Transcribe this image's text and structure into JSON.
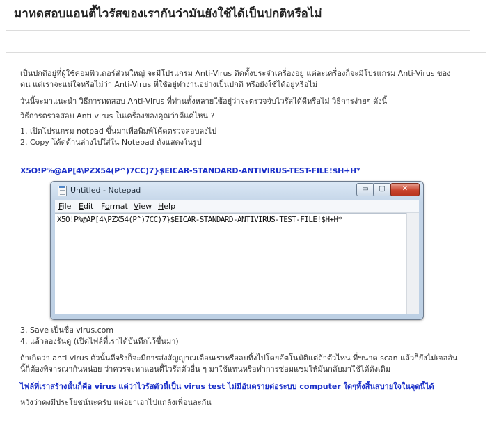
{
  "page": {
    "title": "มาทดสอบแอนตี้ไวรัสของเรากันว่ามันยังใช้ได้เป็นปกติหรือไม่"
  },
  "body": {
    "p1": "เป็นปกติอยู่ที่ผู้ใช้คอมพิวเตอร์ส่วนใหญ่ จะมีโปรแกรม Anti-Virus ติดตั้งประจำเครื่องอยู่ แต่ละเครื่องก็จะมีโปรแกรม Anti-Virus ของตน แต่เราจะแน่ใจหรือไม่ว่า Anti-Virus ที่ใช้อยู่ทำงานอย่างเป็นปกติ หรือยังใช้ได้อยู่หรือไม่",
    "p2": "วันนี้จะมาแนะนำ วิธีการทดสอบ Anti-Virus ที่ท่านทั้งหลายใช้อยู่ว่าจะตรวจจับไวรัสได้ดีหรือไม่ วิธีการง่ายๆ ดังนี้",
    "p3": "วิธีการตรวจสอบ Anti virus ในเครื่องของคุณว่าดีแค่ไหน ?",
    "step1": "1. เปิดโปรแกรม notpad ขึ้นมาเพื่อพิมพ์โค้ดตรวจสอบลงไป",
    "step2": "2. Copy โค้ดด้านล่างไปใส่ใน Notepad ดังแสดงในรูป",
    "code": "X5O!P%@AP[4\\PZX54(P^)7CC)7}$EICAR-STANDARD-ANTIVIRUS-TEST-FILE!$H+H*",
    "step3": "3. Save เป็นชื่อ virus.com",
    "step4": "4. แล้วลองรันดู (เปิดไฟล์ที่เราได้บันทึกไว้ขึ้นมา)",
    "p4": "ถ้าเกิดว่า anti virus ตัวนั้นดีจริงก็จะมีการส่งสัญญาณเตือนเราหรือลบทิ้งไปโดยอัตโนมัติแต่ถ้าตัวไหน ที่ขนาด scan แล้วก็ยังไม่เจออันนี้ก็ต้องพิจารณากันหน่อย ว่าควรจะหาแอนตี้ไวรัสตัวอื่น ๆ มาใช้แทนหรือทำการซ่อมแซมให้มันกลับมาใช้ได้ดังเดิม",
    "blue_note": "ไฟล์ที่เราสร้างนั้นก็คือ virus แต่ว่าไวรัสตัวนี้เป็น virus test ไม่มีอันตรายต่อระบบ computer ใดๆทั้งสิ้นสบายใจในจุดนี้ได้",
    "p5": "หวังว่าคงมีประโยชน์นะครับ แต่อย่าเอาไปแกล้งเพื่อนละกัน"
  },
  "notepad": {
    "window_title": "Untitled - Notepad",
    "menu": [
      {
        "key": "F",
        "rest": "ile"
      },
      {
        "key": "E",
        "rest": "dit"
      },
      {
        "pre": "F",
        "key": "o",
        "rest": "rmat"
      },
      {
        "key": "V",
        "rest": "iew"
      },
      {
        "key": "H",
        "rest": "elp"
      }
    ],
    "content": "X5O!P%@AP[4\\PZX54(P^)7CC)7}$EICAR-STANDARD-ANTIVIRUS-TEST-FILE!$H+H*",
    "controls": {
      "minimize": "▭",
      "maximize": "▢",
      "close": "✕"
    }
  },
  "colors": {
    "blue_text": "#1a2fc8",
    "title_bar": "#c4d5e8",
    "close_button": "#c9452f"
  }
}
